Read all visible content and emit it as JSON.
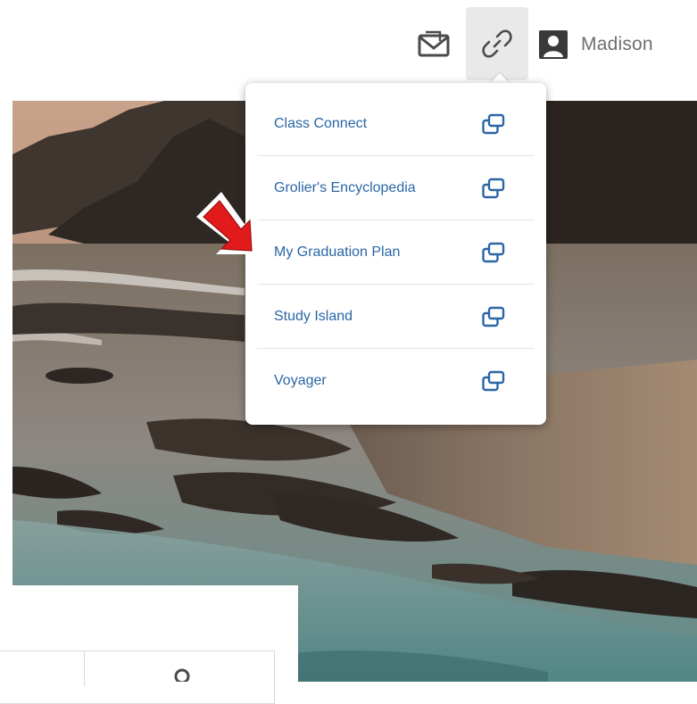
{
  "header": {
    "user_name": "Madison"
  },
  "icons": {
    "messages": "envelope-icon",
    "links": "chain-link-icon",
    "user": "user-avatar-icon",
    "external": "external-window-icon"
  },
  "colors": {
    "link_text": "#2b66a6",
    "icon_dark": "#4b4b4b",
    "active_button_bg": "#e9e9e9",
    "annotation_red": "#e11b1b"
  },
  "links_menu": {
    "items": [
      {
        "label": "Class Connect"
      },
      {
        "label": "Grolier's Encyclopedia"
      },
      {
        "label": "My Graduation Plan"
      },
      {
        "label": "Study Island"
      },
      {
        "label": "Voyager"
      }
    ]
  }
}
